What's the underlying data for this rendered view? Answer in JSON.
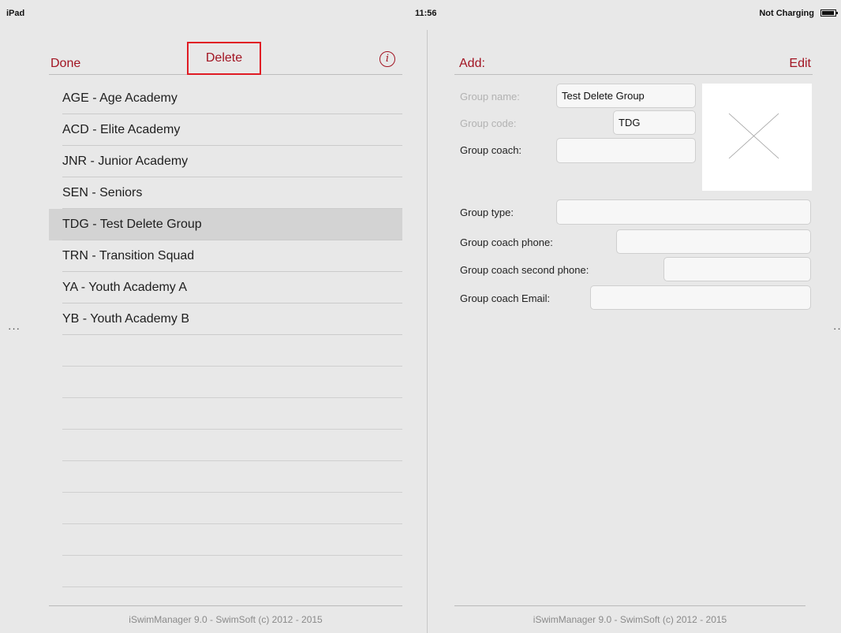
{
  "status": {
    "device": "iPad",
    "time": "11:56",
    "charging": "Not Charging"
  },
  "left": {
    "toolbar": {
      "done_label": "Done",
      "delete_label": "Delete"
    },
    "groups": [
      "AGE - Age Academy",
      "ACD - Elite Academy",
      "JNR - Junior Academy",
      "SEN - Seniors",
      "TDG - Test Delete Group",
      "TRN - Transition Squad",
      "YA - Youth Academy A",
      "YB - Youth Academy B"
    ],
    "selected_group": "TDG - Test Delete Group",
    "footer": "iSwimManager 9.0 - SwimSoft (c) 2012 - 2015"
  },
  "right": {
    "toolbar": {
      "add_label": "Add:",
      "edit_label": "Edit"
    },
    "form": {
      "group_name_label": "Group name:",
      "group_name_value": "Test Delete Group",
      "group_code_label": "Group code:",
      "group_code_value": "TDG",
      "group_coach_label": "Group coach:",
      "group_coach_value": "",
      "group_type_label": "Group type:",
      "group_type_value": "",
      "coach_phone_label": "Group coach phone:",
      "coach_phone_value": "",
      "coach_second_phone_label": "Group coach second phone:",
      "coach_second_phone_value": "",
      "coach_email_label": "Group coach Email:",
      "coach_email_value": ""
    },
    "footer": "iSwimManager 9.0 - SwimSoft (c) 2012 - 2015"
  },
  "colors": {
    "accent": "#a21422",
    "highlight_border": "#e01b24",
    "background": "#e8e8e8",
    "selected_row": "#d3d3d3"
  },
  "icons": {
    "info": "info-circle-icon",
    "battery": "battery-icon",
    "photo_placeholder": "image-placeholder-icon"
  }
}
